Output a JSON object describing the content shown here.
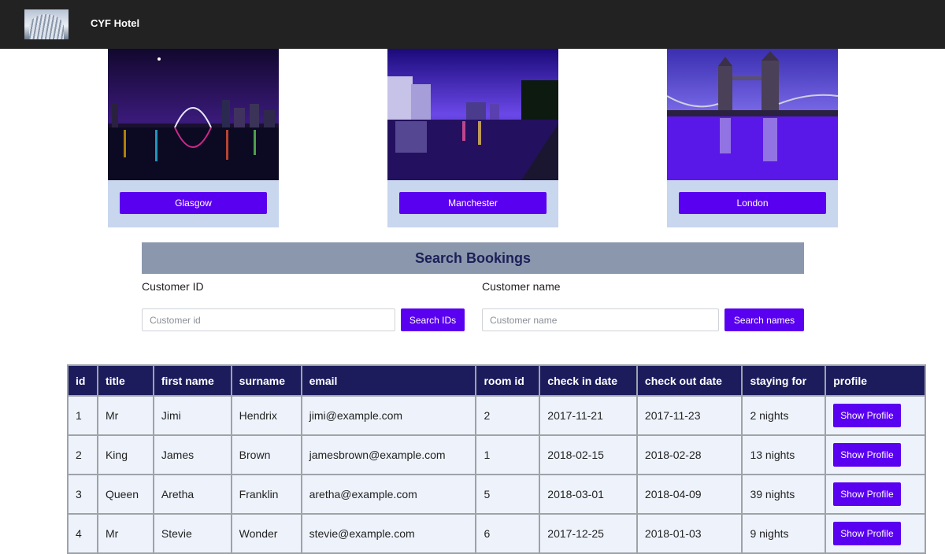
{
  "header": {
    "brand": "CYF Hotel",
    "logo_icon": "hotel-building-logo"
  },
  "cities": [
    {
      "name": "Glasgow",
      "photo_icon": "glasgow-skyline-photo"
    },
    {
      "name": "Manchester",
      "photo_icon": "manchester-skyline-photo"
    },
    {
      "name": "London",
      "photo_icon": "london-tower-bridge-photo"
    }
  ],
  "search": {
    "title": "Search Bookings",
    "customer_id": {
      "label": "Customer ID",
      "placeholder": "Customer id",
      "button": "Search IDs"
    },
    "customer_name": {
      "label": "Customer name",
      "placeholder": "Customer name",
      "button": "Search names"
    }
  },
  "table": {
    "headers": [
      "id",
      "title",
      "first name",
      "surname",
      "email",
      "room id",
      "check in date",
      "check out date",
      "staying for",
      "profile"
    ],
    "rows": [
      {
        "id": "1",
        "title": "Mr",
        "first": "Jimi",
        "surname": "Hendrix",
        "email": "jimi@example.com",
        "room": "2",
        "checkin": "2017-11-21",
        "checkout": "2017-11-23",
        "stay": "2 nights",
        "profile": "Show Profile"
      },
      {
        "id": "2",
        "title": "King",
        "first": "James",
        "surname": "Brown",
        "email": "jamesbrown@example.com",
        "room": "1",
        "checkin": "2018-02-15",
        "checkout": "2018-02-28",
        "stay": "13 nights",
        "profile": "Show Profile"
      },
      {
        "id": "3",
        "title": "Queen",
        "first": "Aretha",
        "surname": "Franklin",
        "email": "aretha@example.com",
        "room": "5",
        "checkin": "2018-03-01",
        "checkout": "2018-04-09",
        "stay": "39 nights",
        "profile": "Show Profile"
      },
      {
        "id": "4",
        "title": "Mr",
        "first": "Stevie",
        "surname": "Wonder",
        "email": "stevie@example.com",
        "room": "6",
        "checkin": "2017-12-25",
        "checkout": "2018-01-03",
        "stay": "9 nights",
        "profile": "Show Profile"
      }
    ]
  },
  "colors": {
    "accent": "#5a00f0",
    "header_bg": "#222222",
    "table_header": "#1c1c5c",
    "card_bg": "#c8d6ee"
  }
}
